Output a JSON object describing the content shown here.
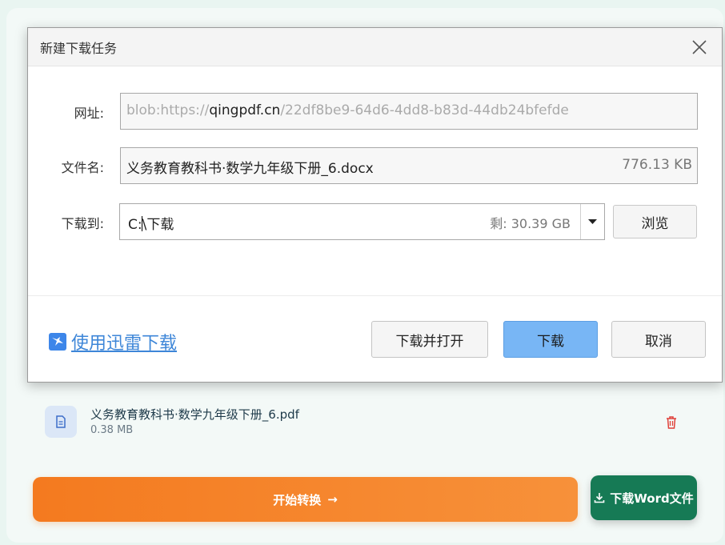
{
  "page": {
    "file": {
      "name": "义务教育教科书·数学九年级下册_6.pdf",
      "size": "0.38 MB",
      "icon": "document-icon",
      "delete_icon": "trash-icon"
    },
    "convert_button": "开始转换",
    "convert_arrow": "→",
    "download_word_button": "下载Word文件"
  },
  "dialog": {
    "title": "新建下载任务",
    "url_label": "网址:",
    "url_prefix": "blob:https://",
    "url_host": "qingpdf.cn",
    "url_suffix": "/22df8be9-64d6-4dd8-b83d-44db24bfefde",
    "filename_label": "文件名:",
    "filename_value": "义务教育教科书·数学九年级下册_6.docx",
    "filename_size": "776.13 KB",
    "saveto_label": "下载到:",
    "saveto_drive": "C:",
    "saveto_folder": "下载",
    "saveto_free": "剩: 30.39 GB",
    "browse_button": "浏览",
    "thunder_link": "使用迅雷下载",
    "download_open_button": "下载并打开",
    "download_button": "下载",
    "cancel_button": "取消"
  },
  "colors": {
    "accent_orange": "#f47a1f",
    "accent_green": "#167a55",
    "primary_blue": "#78b6f5",
    "link_blue": "#3d86d8"
  }
}
